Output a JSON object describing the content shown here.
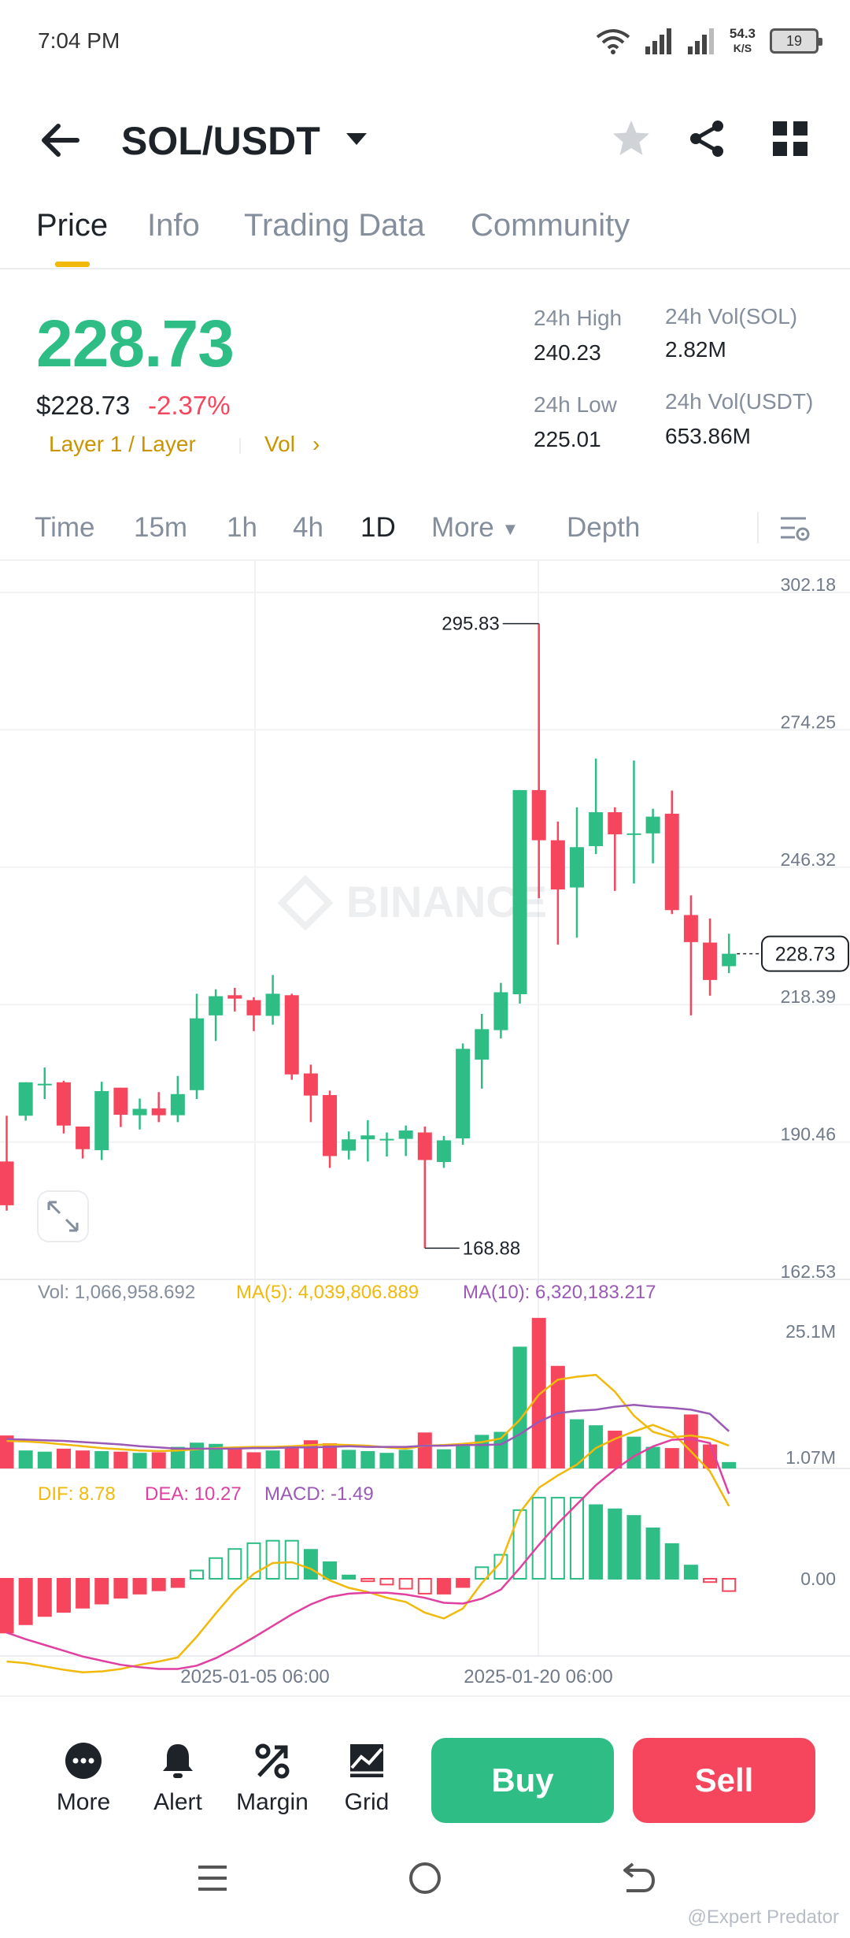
{
  "status": {
    "time": "7:04 PM",
    "speed_value": "54.3",
    "speed_unit": "K/S",
    "battery": "19"
  },
  "header": {
    "pair": "SOL/USDT"
  },
  "tabs": [
    "Price",
    "Info",
    "Trading Data",
    "Community"
  ],
  "price": {
    "last": "228.73",
    "usd": "$228.73",
    "change": "-2.37%",
    "tag1": "Layer 1 / Layer",
    "tag2": "Vol",
    "stats": {
      "high_label": "24h High",
      "high": "240.23",
      "low_label": "24h Low",
      "low": "225.01",
      "vol_sol_label": "24h Vol(SOL)",
      "vol_sol": "2.82M",
      "vol_usdt_label": "24h Vol(USDT)",
      "vol_usdt": "653.86M"
    }
  },
  "intervals": [
    "Time",
    "15m",
    "1h",
    "4h",
    "1D",
    "More",
    "Depth"
  ],
  "watermark": "BINANCE",
  "chart_data": {
    "type": "candlestick",
    "interval": "1D",
    "y_ticks": [
      "302.18",
      "274.25",
      "246.32",
      "218.39",
      "190.46",
      "162.53"
    ],
    "ylim": [
      162.53,
      302.18
    ],
    "x_ticks": [
      "2025-01-05 06:00",
      "2025-01-20 06:00"
    ],
    "max_label": "295.83",
    "min_label": "168.88",
    "last_price_label": "228.73",
    "candles": [
      [
        186.5,
        195.8,
        176.5,
        177.6
      ],
      [
        195.8,
        202.6,
        194.8,
        202.6
      ],
      [
        202.1,
        205.6,
        199.2,
        202.3
      ],
      [
        202.6,
        202.9,
        192.2,
        193.8
      ],
      [
        193.6,
        193.6,
        187.1,
        189.0
      ],
      [
        188.8,
        202.7,
        186.8,
        200.8
      ],
      [
        201.5,
        201.5,
        193.5,
        196.0
      ],
      [
        195.9,
        199.3,
        193.0,
        197.2
      ],
      [
        197.3,
        200.6,
        194.5,
        195.9
      ],
      [
        195.9,
        203.9,
        194.5,
        200.2
      ],
      [
        201.0,
        220.6,
        199.2,
        215.6
      ],
      [
        216.2,
        221.5,
        211.0,
        220.1
      ],
      [
        220.3,
        221.8,
        217.0,
        219.6
      ],
      [
        219.3,
        219.9,
        213.0,
        216.2
      ],
      [
        216.1,
        224.4,
        214.3,
        220.6
      ],
      [
        220.3,
        220.6,
        203.1,
        204.2
      ],
      [
        204.4,
        206.2,
        194.5,
        199.9
      ],
      [
        200.0,
        200.9,
        185.2,
        187.6
      ],
      [
        188.7,
        192.6,
        186.9,
        191.0
      ],
      [
        191.0,
        194.9,
        186.5,
        191.8
      ],
      [
        190.9,
        192.4,
        187.5,
        191.1
      ],
      [
        191.1,
        193.8,
        187.6,
        192.8
      ],
      [
        192.4,
        193.6,
        168.88,
        186.8
      ],
      [
        186.4,
        191.7,
        185.2,
        190.8
      ],
      [
        191.2,
        210.5,
        189.9,
        209.4
      ],
      [
        207.2,
        216.5,
        201.3,
        213.4
      ],
      [
        213.2,
        222.8,
        211.5,
        220.9
      ],
      [
        220.5,
        262.0,
        218.6,
        262.0
      ],
      [
        262.0,
        295.83,
        240.0,
        251.8
      ],
      [
        251.8,
        255.6,
        230.6,
        241.8
      ],
      [
        242.2,
        258.5,
        232.0,
        250.4
      ],
      [
        250.6,
        268.4,
        249.0,
        257.5
      ],
      [
        257.5,
        258.5,
        241.5,
        253.0
      ],
      [
        253.0,
        268.0,
        243.0,
        253.2
      ],
      [
        253.2,
        258.2,
        247.1,
        256.6
      ],
      [
        257.2,
        261.9,
        236.8,
        237.6
      ],
      [
        236.6,
        240.6,
        216.2,
        231.1
      ],
      [
        231.0,
        235.9,
        220.2,
        223.4
      ],
      [
        226.2,
        232.8,
        224.8,
        228.73
      ]
    ],
    "volume": {
      "header_label": "Vol: 1,066,958.692",
      "ma5_label": "MA(5): 4,039,806.889",
      "ma10_label": "MA(10): 6,320,183.217",
      "y_ticks": [
        "25.1M",
        "1.07M"
      ],
      "ylim": [
        0,
        26.0
      ],
      "values": [
        5.5,
        3.0,
        2.8,
        3.3,
        3.0,
        2.9,
        2.8,
        2.6,
        2.7,
        3.6,
        4.3,
        4.1,
        3.4,
        2.7,
        3.0,
        3.8,
        4.7,
        4.2,
        3.1,
        2.9,
        2.6,
        3.1,
        6.0,
        3.2,
        4.2,
        5.6,
        6.1,
        20.3,
        25.1,
        17.1,
        8.2,
        7.2,
        6.3,
        5.3,
        3.6,
        3.4,
        9.0,
        4.0,
        1.07
      ],
      "ma5": [
        4.6,
        4.5,
        4.3,
        4.0,
        3.7,
        3.4,
        3.2,
        3.0,
        2.9,
        3.0,
        3.2,
        3.4,
        3.5,
        3.6,
        3.6,
        3.7,
        3.9,
        4.0,
        3.9,
        3.8,
        3.5,
        3.3,
        3.8,
        3.9,
        4.1,
        4.4,
        5.0,
        8.1,
        12.3,
        14.8,
        15.3,
        15.6,
        12.8,
        8.8,
        6.1,
        5.2,
        5.5,
        5.0,
        3.8
      ],
      "ma10": [
        4.9,
        4.8,
        4.7,
        4.6,
        4.4,
        4.2,
        4.0,
        3.7,
        3.5,
        3.3,
        3.3,
        3.3,
        3.3,
        3.4,
        3.4,
        3.5,
        3.5,
        3.6,
        3.7,
        3.6,
        3.6,
        3.6,
        3.8,
        3.8,
        3.9,
        3.9,
        4.0,
        5.7,
        7.8,
        9.2,
        9.6,
        9.8,
        10.3,
        10.6,
        10.3,
        10.1,
        9.8,
        9.1,
        6.2
      ]
    },
    "macd": {
      "dif_label": "DIF: 8.78",
      "dea_label": "DEA: 10.27",
      "macd_label": "MACD: -1.49",
      "zero_label": "0.00",
      "ylim": [
        -12,
        20
      ],
      "hist": [
        -6.5,
        -5.5,
        -4.5,
        -4.0,
        -3.5,
        -3.0,
        -2.3,
        -1.8,
        -1.4,
        -1.0,
        1.0,
        2.5,
        3.6,
        4.3,
        4.6,
        4.6,
        3.5,
        2.0,
        0.4,
        -0.3,
        -0.7,
        -1.2,
        -1.8,
        -1.8,
        -1.0,
        1.4,
        2.9,
        8.3,
        9.8,
        9.8,
        9.8,
        8.9,
        8.4,
        7.6,
        6.1,
        4.2,
        1.6,
        -0.4,
        -1.49
      ],
      "dif": [
        -10.0,
        -10.2,
        -10.6,
        -11.0,
        -11.3,
        -11.2,
        -10.9,
        -10.4,
        -10.0,
        -9.5,
        -7.0,
        -4.2,
        -1.5,
        0.6,
        1.9,
        2.0,
        1.2,
        -0.2,
        -1.1,
        -1.6,
        -2.3,
        -2.8,
        -4.1,
        -4.8,
        -3.6,
        -0.5,
        2.0,
        8.0,
        11.0,
        12.5,
        13.8,
        15.8,
        16.9,
        17.8,
        18.6,
        17.7,
        15.4,
        13.0,
        8.78
      ],
      "dea": [
        -6.5,
        -7.3,
        -8.0,
        -8.7,
        -9.4,
        -9.9,
        -10.4,
        -10.7,
        -10.9,
        -10.9,
        -10.5,
        -9.6,
        -8.4,
        -7.1,
        -5.7,
        -4.3,
        -3.1,
        -2.2,
        -1.8,
        -1.7,
        -1.7,
        -1.9,
        -2.3,
        -2.9,
        -3.0,
        -2.4,
        -1.3,
        1.3,
        4.1,
        6.7,
        9.0,
        11.3,
        13.2,
        14.8,
        16.0,
        16.8,
        16.9,
        16.4,
        10.27
      ]
    },
    "colors": {
      "up": "#2ebd85",
      "down": "#f6465d",
      "ma5": "#f0b90b",
      "ma10": "#9b59b6",
      "dif": "#f0b90b",
      "dea": "#e040a0"
    }
  },
  "bottom": {
    "more": "More",
    "alert": "Alert",
    "margin": "Margin",
    "grid": "Grid",
    "buy": "Buy",
    "sell": "Sell"
  },
  "credit": "@Expert Predator"
}
